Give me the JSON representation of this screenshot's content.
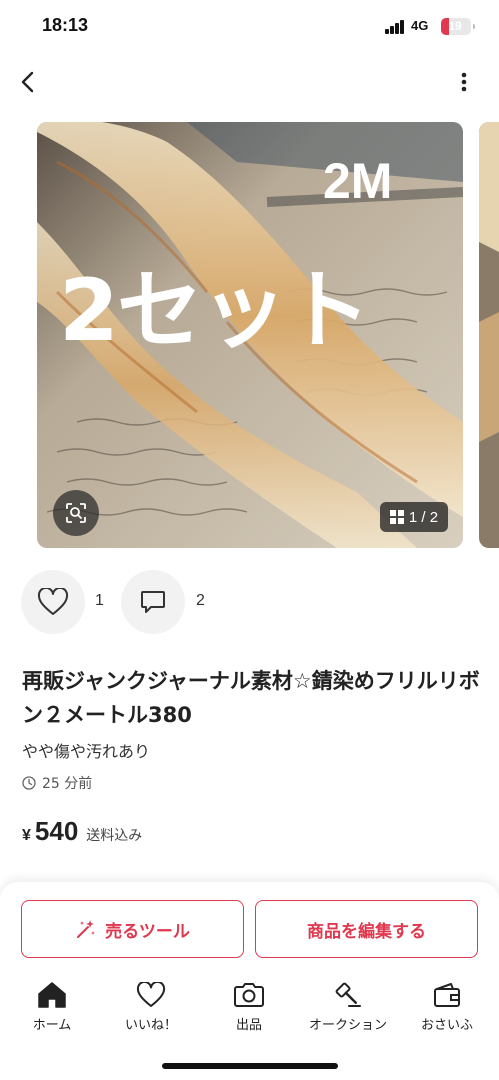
{
  "status_bar": {
    "time": "18:13",
    "network": "4G",
    "battery": "19"
  },
  "nav": {
    "back_icon": "chevron-left-icon",
    "more_icon": "vertical-dots-icon"
  },
  "photo": {
    "overlay_top": "2M",
    "overlay_main": "2セット",
    "counter": "1 / 2",
    "zoom_icon": "image-search-icon"
  },
  "reactions": {
    "likes": "1",
    "comments": "2"
  },
  "item": {
    "title": "再販ジャンクジャーナル素材☆錆染めフリルリボン２メートル380",
    "condition": "やや傷や汚れあり",
    "posted": "25 分前",
    "currency": "¥",
    "price": "540",
    "shipping": "送料込み"
  },
  "actions": {
    "sell_tools": "売るツール",
    "edit": "商品を編集する"
  },
  "tabs": [
    {
      "label": "ホーム",
      "icon": "home-icon"
    },
    {
      "label": "いいね！",
      "icon": "heart-icon"
    },
    {
      "label": "出品",
      "icon": "camera-icon"
    },
    {
      "label": "オークション",
      "icon": "gavel-icon"
    },
    {
      "label": "おさいふ",
      "icon": "wallet-icon"
    }
  ],
  "colors": {
    "accent": "#e0384e",
    "text": "#222222",
    "button_bg": "#f2f2f2"
  }
}
